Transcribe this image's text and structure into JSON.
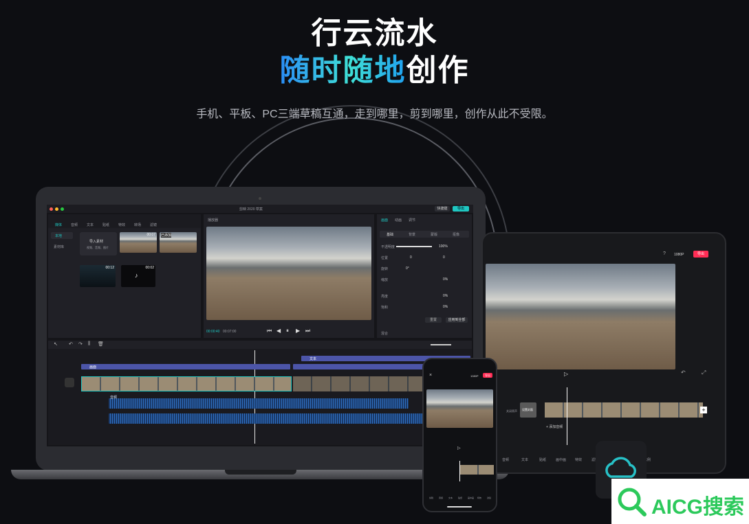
{
  "hero": {
    "line1": "行云流水",
    "line2_gradient": "随时随地",
    "line2_plain": "创作",
    "subtitle": "手机、平板、PC三端草稿互通，走到哪里，剪到哪里，创作从此不受限。"
  },
  "laptop_app": {
    "window_title": "剪映 2020 草案",
    "top_right_buttons": [
      "快捷键",
      "导出"
    ],
    "toolbar_tabs": [
      "媒体",
      "音频",
      "文本",
      "贴纸",
      "特效",
      "转场",
      "滤镜"
    ],
    "sidebar": [
      "本地",
      "素材库"
    ],
    "import_button": "导入素材",
    "import_hint": "视频、音频、图片",
    "media_badges": [
      "00:07",
      "已添加",
      "00:12",
      "00:02"
    ],
    "player_title": "播放器",
    "player_time_current": "00:00:40",
    "player_time_total": "00:07:00",
    "inspector_tabs": [
      "画面",
      "动画",
      "调节"
    ],
    "inspector_subtabs": [
      "基础",
      "背景",
      "蒙版",
      "抠像"
    ],
    "inspector_rows": [
      {
        "label": "不透明度",
        "value": "100%"
      },
      {
        "label": "位置",
        "x": "0",
        "y": "0"
      },
      {
        "label": "旋转",
        "value": "0°"
      },
      {
        "label": "缩放",
        "value": "0%"
      },
      {
        "label": "亮度",
        "value": "0%"
      },
      {
        "label": "饱和",
        "value": "0%"
      }
    ],
    "inspector_buttons": [
      "重置",
      "应用到全部"
    ],
    "inspector_footer": "混合",
    "timeline_labels": [
      "画面",
      "文本",
      "音频"
    ]
  },
  "tablet_app": {
    "resolution": "1080P",
    "export_button": "导出",
    "tool_labels": [
      "音频",
      "文本",
      "贴纸",
      "画中画",
      "特效",
      "滤镜",
      "比例"
    ],
    "cover_label": "设置封面",
    "add_text": "+ 添加音频",
    "mute_label": "关闭原声"
  },
  "phone_app": {
    "resolution": "1080P",
    "export_button": "导出",
    "tool_labels": [
      "剪辑",
      "音频",
      "文本",
      "贴纸",
      "画中画",
      "特效",
      "滤镜"
    ]
  },
  "watermark": "AICG搜索"
}
